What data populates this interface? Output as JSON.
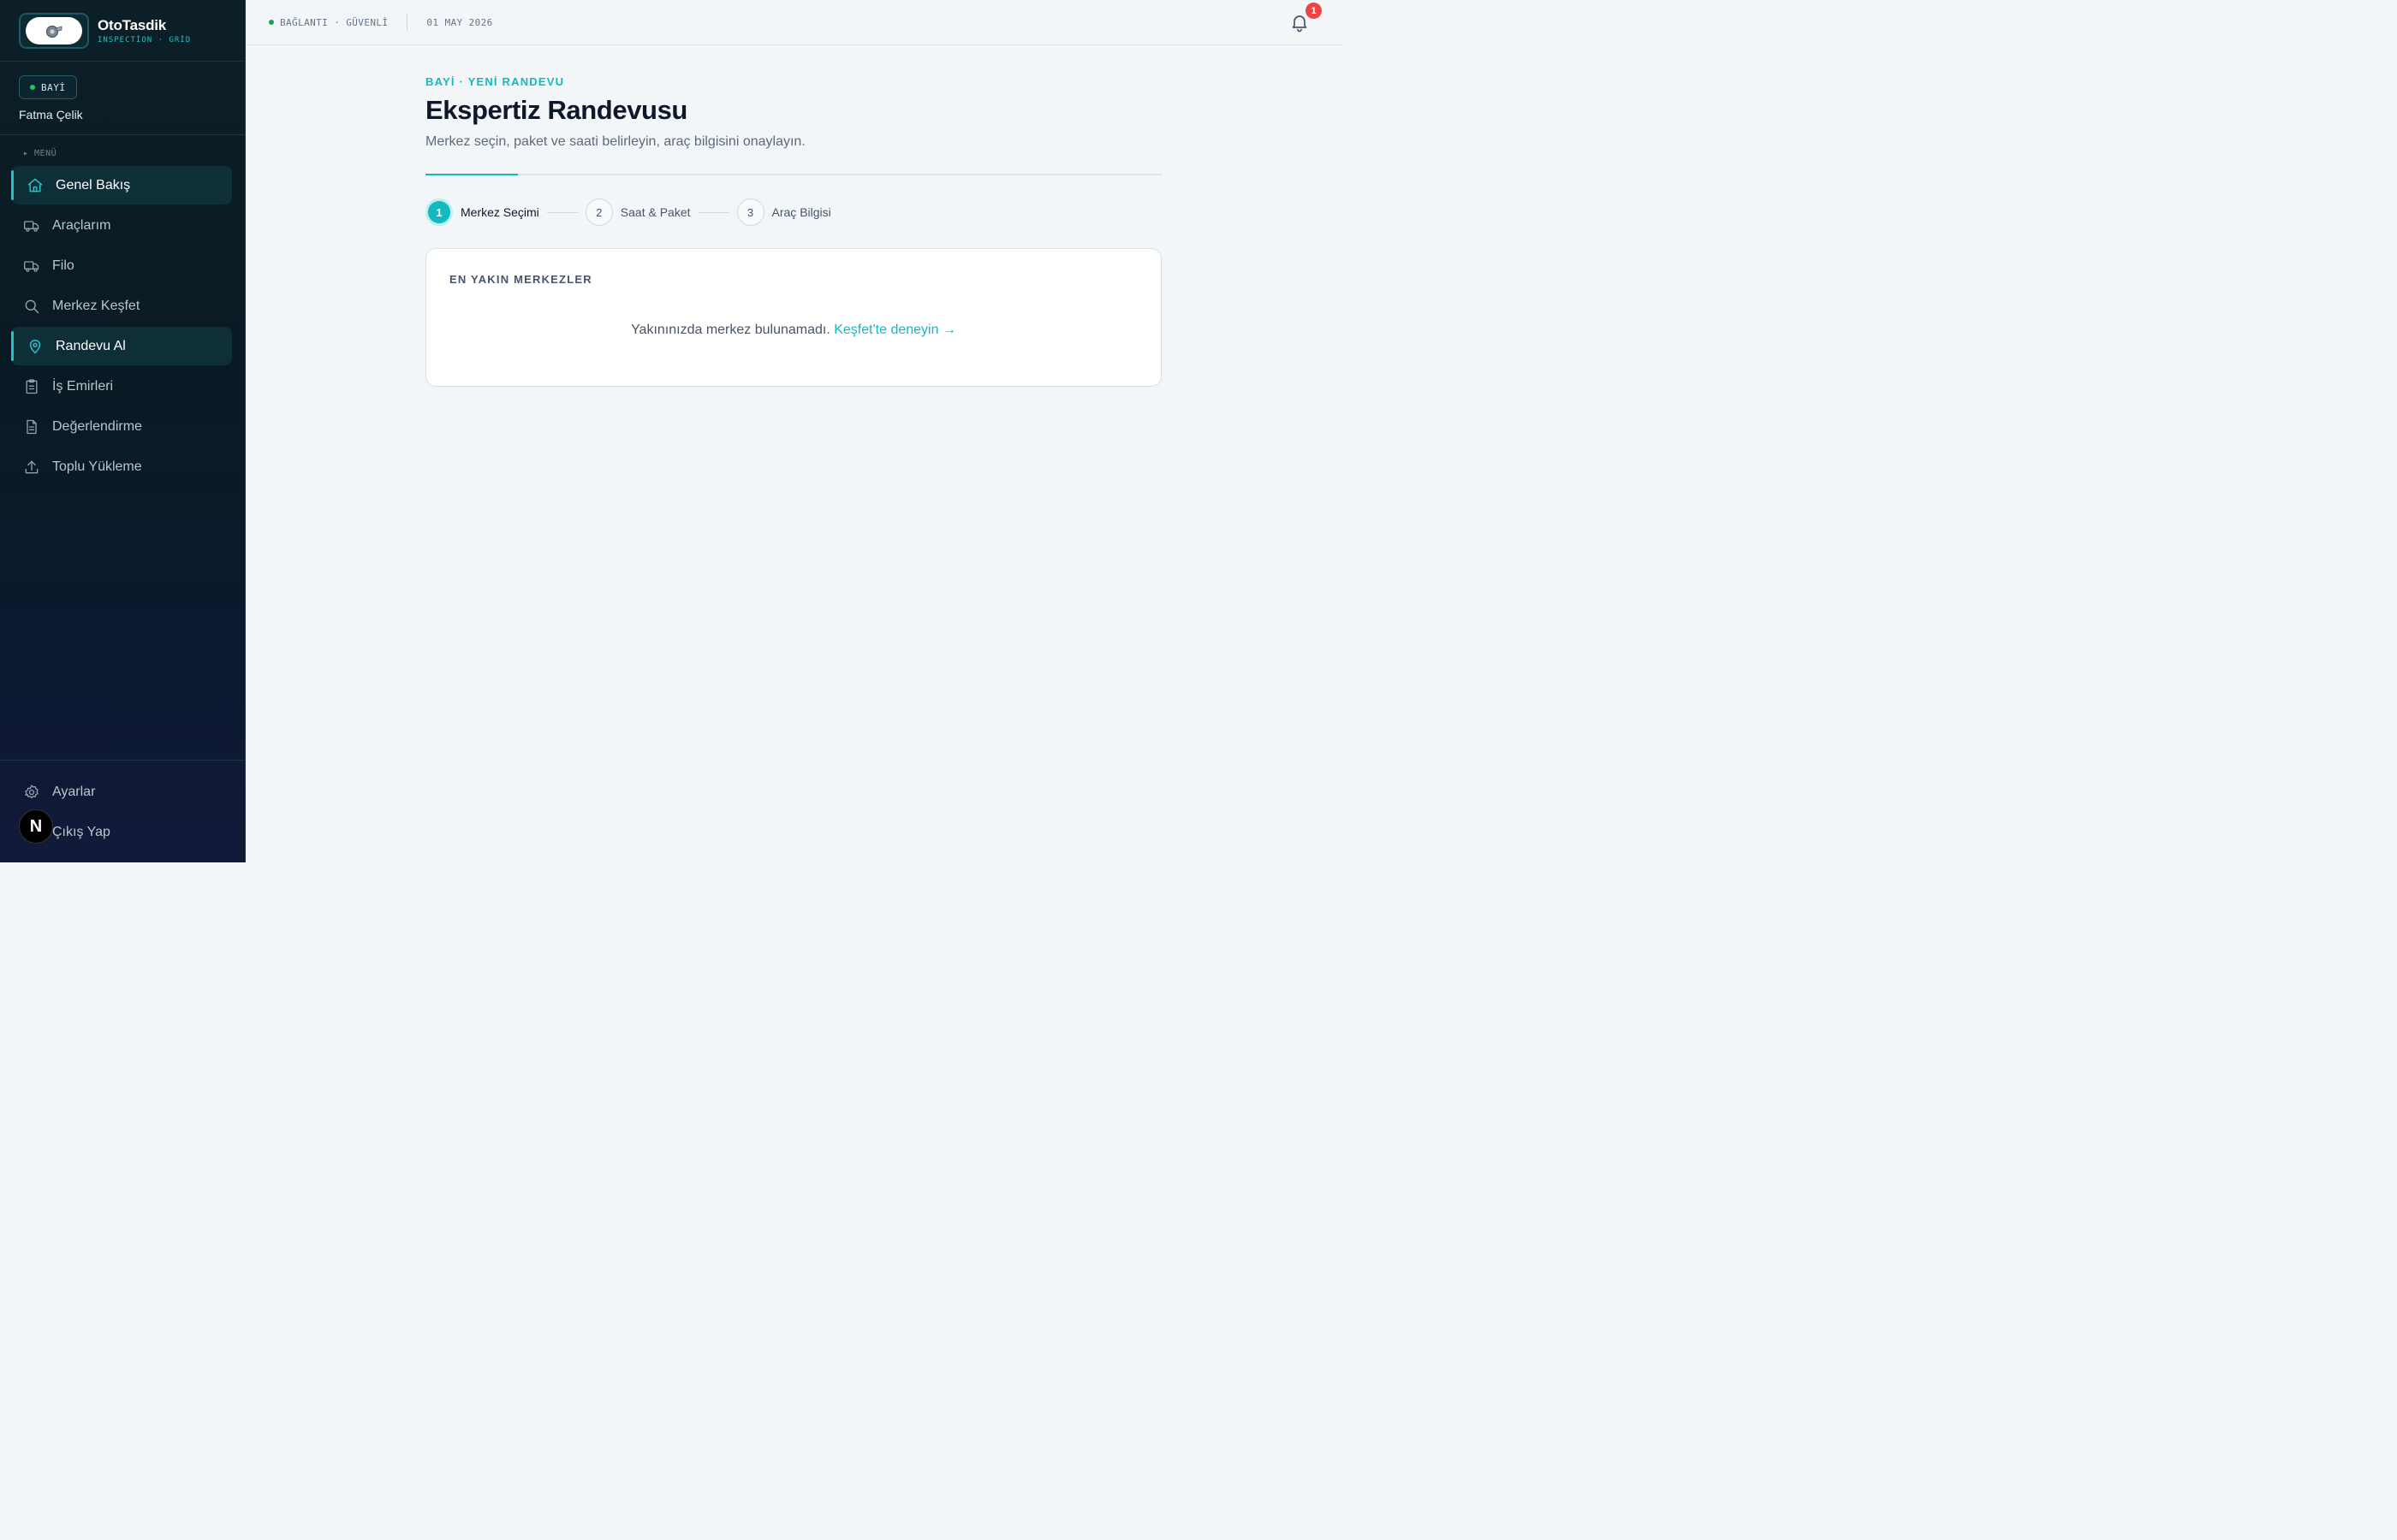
{
  "brand": {
    "name": "OtoTasdik",
    "tagline": "INSPECTİON · GRİD"
  },
  "user": {
    "role": "BAYİ",
    "name": "Fatma Çelik"
  },
  "sidebar": {
    "menu_title": "▸ MENÜ",
    "items": [
      {
        "label": "Genel Bakış",
        "icon": "home-icon",
        "active": true
      },
      {
        "label": "Araçlarım",
        "icon": "truck-icon",
        "active": false
      },
      {
        "label": "Filo",
        "icon": "truck-icon",
        "active": false
      },
      {
        "label": "Merkez Keşfet",
        "icon": "search-icon",
        "active": false
      },
      {
        "label": "Randevu Al",
        "icon": "map-pin-icon",
        "active": true
      },
      {
        "label": "İş Emirleri",
        "icon": "clipboard-icon",
        "active": false
      },
      {
        "label": "Değerlendirme",
        "icon": "document-icon",
        "active": false
      },
      {
        "label": "Toplu Yükleme",
        "icon": "upload-icon",
        "active": false
      }
    ],
    "footer": [
      {
        "label": "Ayarlar",
        "icon": "gear-icon"
      },
      {
        "label": "Çıkış Yap",
        "icon": "logout-icon"
      }
    ],
    "dev_badge": "N"
  },
  "topbar": {
    "status": "BAĞLANTI · GÜVENLİ",
    "date": "01 MAY 2026",
    "notification_count": "1"
  },
  "main": {
    "eyebrow": "BAYİ · YENİ RANDEVU",
    "title": "Ekspertiz Randevusu",
    "subtitle": "Merkez seçin, paket ve saati belirleyin, araç bilgisini onaylayın.",
    "progress_fraction": 0.125,
    "steps": [
      {
        "num": "1",
        "label": "Merkez Seçimi",
        "active": true
      },
      {
        "num": "2",
        "label": "Saat & Paket",
        "active": false
      },
      {
        "num": "3",
        "label": "Araç Bilgisi",
        "active": false
      }
    ],
    "card": {
      "title": "EN YAKIN MERKEZLER",
      "empty_text": "Yakınınızda merkez bulunamadı.",
      "empty_link": "Keşfet'te deneyin →"
    }
  },
  "colors": {
    "accent": "#14b8c0",
    "sidebar_bg": "#0a1a24",
    "badge_red": "#ef4444",
    "status_green": "#16a34a"
  }
}
